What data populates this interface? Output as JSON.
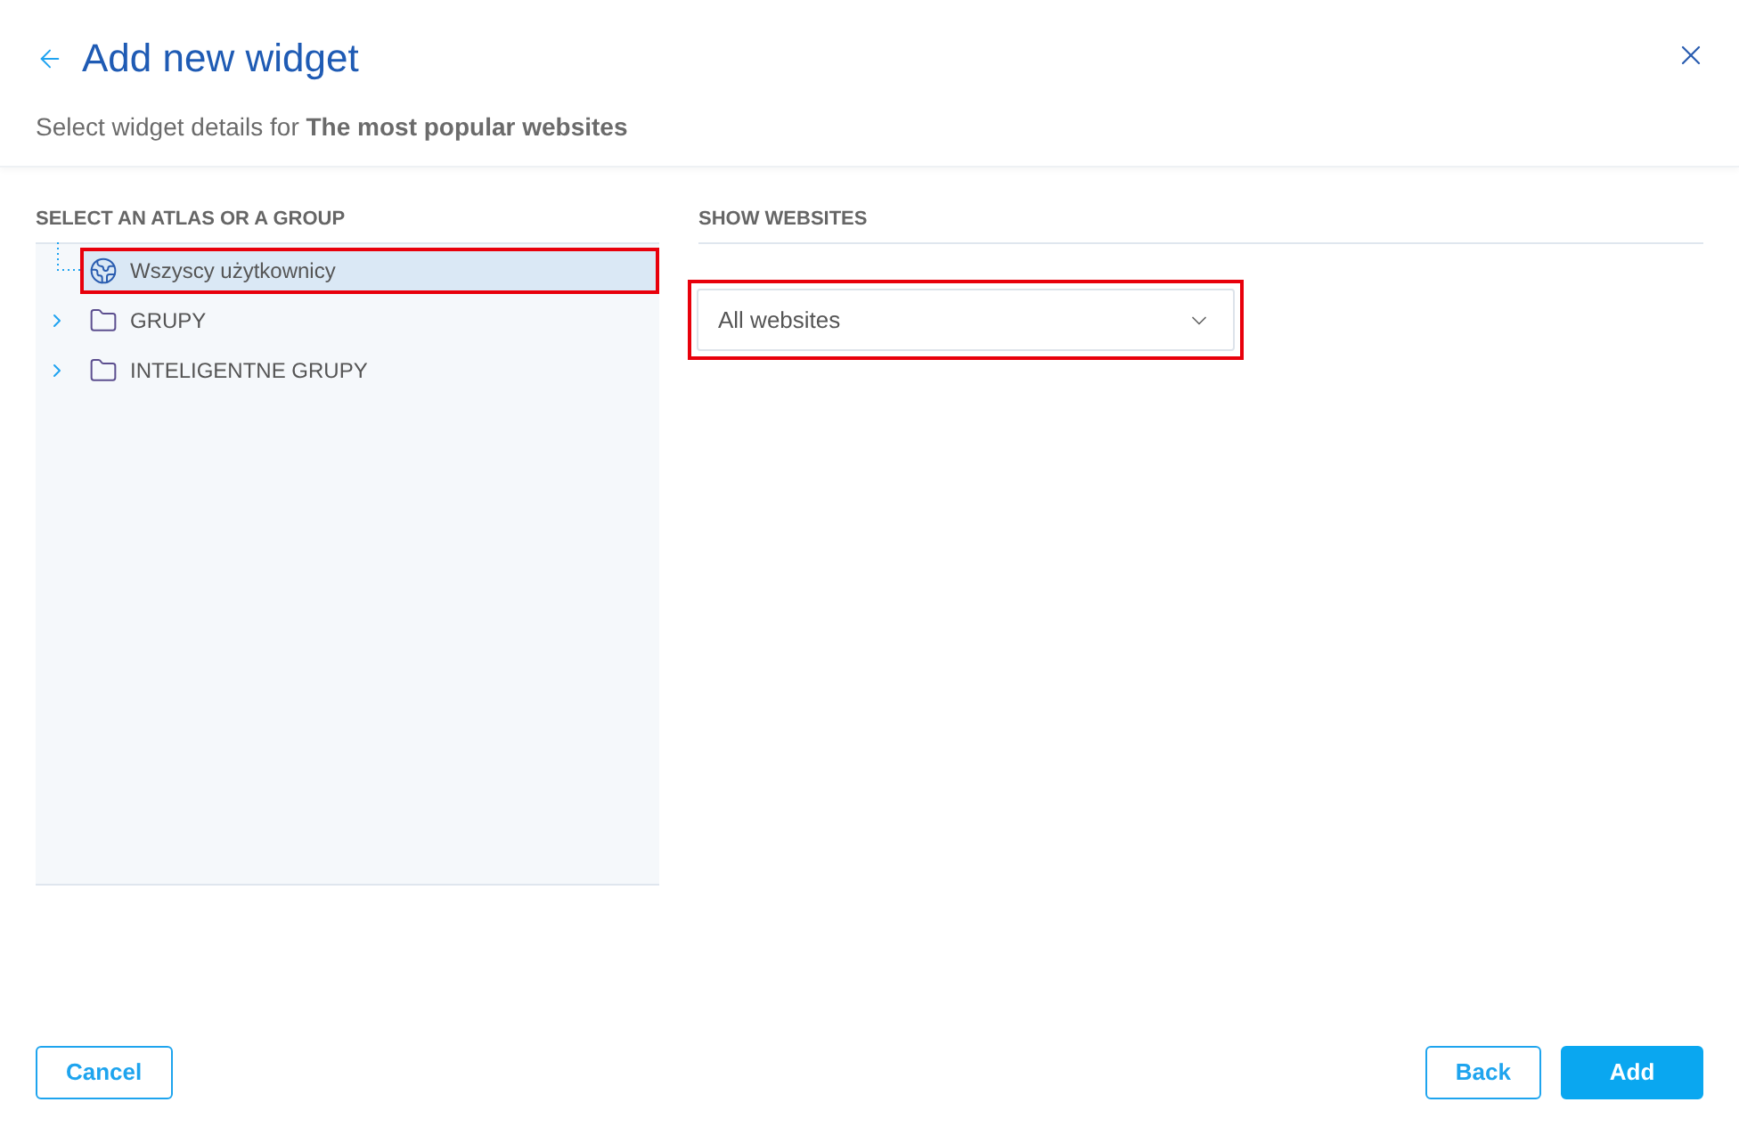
{
  "header": {
    "title": "Add new widget",
    "subtitle": "Select widget details for **The most popular websites**"
  },
  "left_panel": {
    "heading": "SELECT AN ATLAS OR A GROUP",
    "tree": [
      {
        "kind": "globe",
        "label": "Wszyscy użytkownicy",
        "selected": true,
        "highlighted": true
      },
      {
        "kind": "folder",
        "label": "GRUPY",
        "selected": false,
        "highlighted": false,
        "expanded": false
      },
      {
        "kind": "folder",
        "label": "INTELIGENTNE GRUPY",
        "selected": false,
        "highlighted": false,
        "expanded": false
      }
    ]
  },
  "right_panel": {
    "heading": "SHOW WEBSITES",
    "select": {
      "value": "All websites",
      "highlighted": true
    }
  },
  "footer": {
    "left_buttons": [
      {
        "label": "Cancel",
        "kind": "secondary"
      }
    ],
    "right_buttons": [
      {
        "label": "Back",
        "kind": "secondary"
      },
      {
        "label": "Add",
        "kind": "primary"
      }
    ]
  }
}
